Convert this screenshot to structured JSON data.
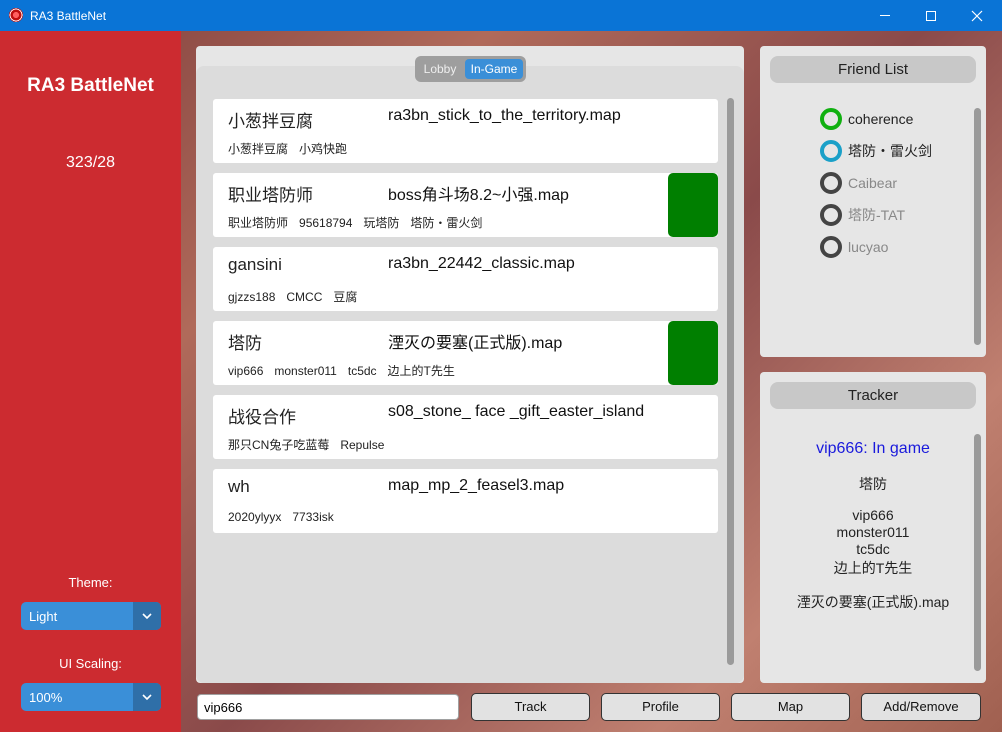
{
  "window": {
    "title": "RA3 BattleNet"
  },
  "sidebar": {
    "brand": "RA3 BattleNet",
    "stats": "323/28",
    "theme_label": "Theme:",
    "theme_value": "Light",
    "scaling_label": "UI Scaling:",
    "scaling_value": "100%"
  },
  "tabs": {
    "lobby": "Lobby",
    "ingame": "In-Game",
    "selected": "In-Game"
  },
  "games": [
    {
      "host": "小葱拌豆腐",
      "map": "ra3bn_stick_to_the_territory.map",
      "players": [
        "小葱拌豆腐",
        "小鸡快跑"
      ],
      "marked": false
    },
    {
      "host": "职业塔防师",
      "map": "boss角斗场8.2~小强.map",
      "players": [
        "职业塔防师",
        "95618794",
        "玩塔防",
        "塔防・雷火剑"
      ],
      "marked": true
    },
    {
      "host": "gansini",
      "map": "ra3bn_22442_classic.map",
      "players": [
        "gjzzs188",
        "CMCC",
        "豆腐"
      ],
      "marked": false
    },
    {
      "host": "塔防",
      "map": "湮灭の要塞(正式版).map",
      "players": [
        "vip666",
        "monster011",
        "tc5dc",
        "边上的T先生"
      ],
      "marked": true
    },
    {
      "host": "战役合作",
      "map": "s08_stone_ face _gift_easter_island",
      "players": [
        "那只CN兔子吃蓝莓",
        "Repulse"
      ],
      "marked": false
    },
    {
      "host": "wh",
      "map": "map_mp_2_feasel3.map",
      "players": [
        "2020ylyyx",
        "7733isk"
      ],
      "marked": false
    }
  ],
  "friends": {
    "title": "Friend List",
    "items": [
      {
        "name": "coherence",
        "status_color": "#10b010",
        "text_color": "#222222"
      },
      {
        "name": "塔防・雷火剑",
        "status_color": "#1aa0c8",
        "text_color": "#222222"
      },
      {
        "name": "Caibear",
        "status_color": "#444444",
        "text_color": "#888888"
      },
      {
        "name": "塔防-TAT",
        "status_color": "#444444",
        "text_color": "#888888"
      },
      {
        "name": "lucyao",
        "status_color": "#444444",
        "text_color": "#888888"
      }
    ]
  },
  "tracker": {
    "title": "Tracker",
    "status": "vip666: In game",
    "status_color": "#1a1adc",
    "host": "塔防",
    "players": [
      "vip666",
      "monster011",
      "tc5dc",
      "边上的T先生"
    ],
    "map": "湮灭の要塞(正式版).map"
  },
  "bottom": {
    "input_value": "vip666",
    "track": "Track",
    "profile": "Profile",
    "map": "Map",
    "add_remove": "Add/Remove"
  },
  "colors": {
    "accent": "#3a8fd8",
    "sidebar": "#cc2b30",
    "titlebar": "#0a74d6",
    "ingame_marker": "#007f00"
  }
}
